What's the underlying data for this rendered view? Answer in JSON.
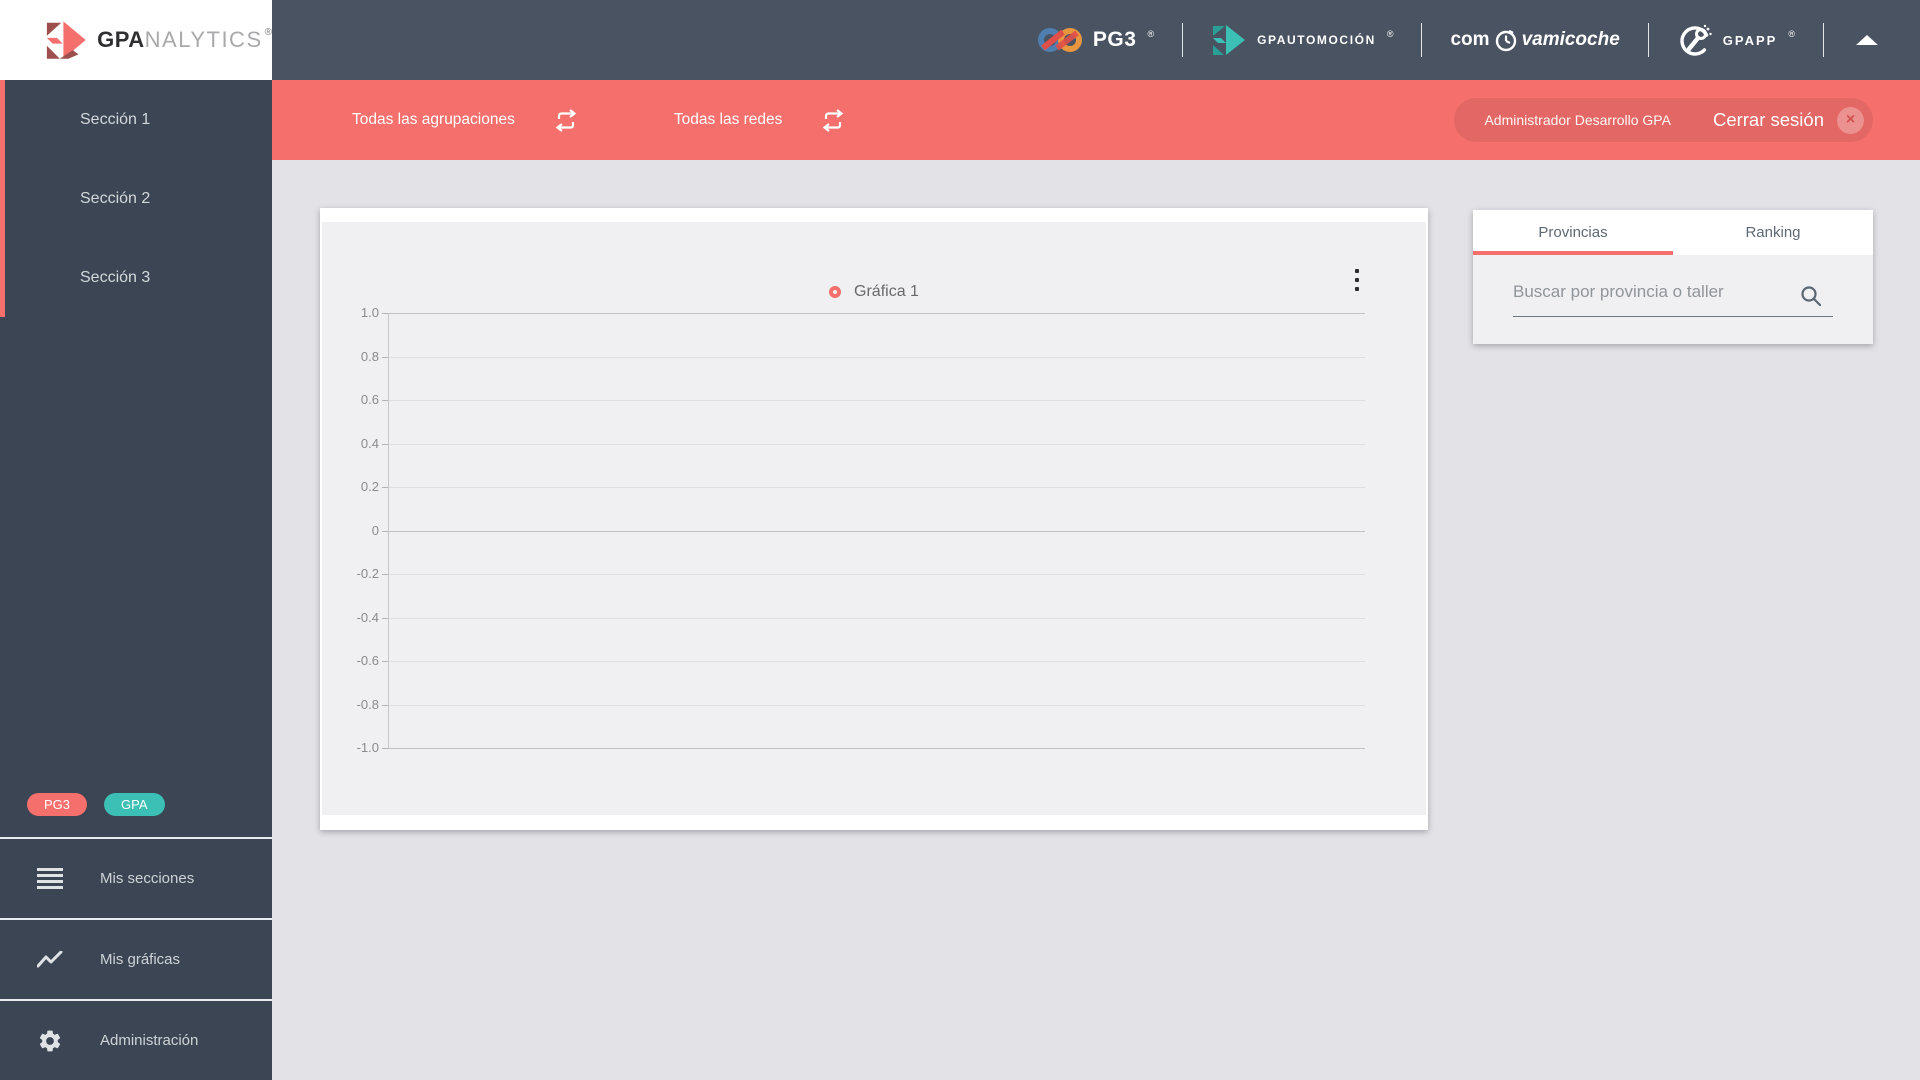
{
  "header": {
    "brand": {
      "bold": "GPA",
      "light": "NALYTICS",
      "reg": "®"
    },
    "partners": {
      "pg3": {
        "label": "PG3",
        "reg": "®"
      },
      "gpautomocion": {
        "label": "GPAUTOMOCIÓN",
        "reg": "®"
      },
      "comvamicoche": {
        "pre": "com",
        "post": "vamicoche"
      },
      "gpapp": {
        "label": "GPAPP",
        "reg": "®"
      }
    }
  },
  "filter_bar": {
    "groupings_label": "Todas las agrupaciones",
    "networks_label": "Todas las redes",
    "user_name": "Administrador Desarrollo GPA",
    "logout_label": "Cerrar sesión",
    "close_glyph": "×"
  },
  "sidebar": {
    "sections": [
      {
        "label": "Sección 1"
      },
      {
        "label": "Sección 2"
      },
      {
        "label": "Sección 3"
      }
    ],
    "badges": [
      {
        "label": "PG3",
        "color": "#f56f6c"
      },
      {
        "label": "GPA",
        "color": "#3cbfb4"
      }
    ],
    "menu": [
      {
        "label": "Mis secciones",
        "icon": "list-icon"
      },
      {
        "label": "Mis gráficas",
        "icon": "line-chart-icon"
      },
      {
        "label": "Administración",
        "icon": "gear-icon"
      }
    ]
  },
  "chart_data": {
    "type": "line",
    "title": "Gráfica 1",
    "series": [
      {
        "name": "Gráfica 1",
        "color": "#f56f6c",
        "x": [],
        "values": []
      }
    ],
    "ylim": [
      -1.0,
      1.0
    ],
    "yticks": [
      1.0,
      0.8,
      0.6,
      0.4,
      0.2,
      0,
      -0.2,
      -0.4,
      -0.6,
      -0.8,
      -1.0
    ],
    "ytick_labels": [
      "1.0",
      "0.8",
      "0.6",
      "0.4",
      "0.2",
      "0",
      "-0.2",
      "-0.4",
      "-0.6",
      "-0.8",
      "-1.0"
    ],
    "xticks": [],
    "grid": true,
    "legend_position": "top-center",
    "plot_background": "#f0f0f3"
  },
  "right_panel": {
    "tabs": [
      {
        "label": "Provincias",
        "active": true
      },
      {
        "label": "Ranking",
        "active": false
      }
    ],
    "search_placeholder": "Buscar por provincia o taller"
  },
  "colors": {
    "header_bg": "#495362",
    "sidebar_bg": "#3b4553",
    "accent_red": "#f56f6c",
    "accent_teal": "#3cbfb4",
    "page_bg": "#e3e2e7",
    "card_bg": "#ffffff",
    "plot_bg": "#f0f0f3"
  }
}
